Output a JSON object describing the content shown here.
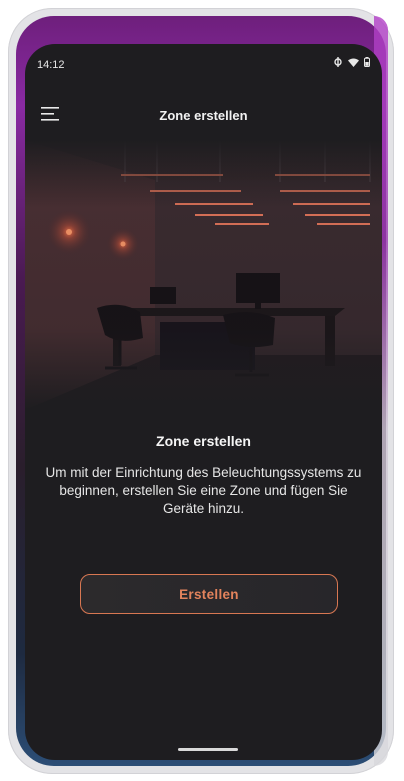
{
  "status_bar": {
    "time": "14:12",
    "icons": [
      "sync-icon",
      "wifi-icon",
      "battery-icon"
    ]
  },
  "app_bar": {
    "title": "Zone erstellen",
    "menu_icon": "hamburger-menu-icon"
  },
  "content": {
    "title": "Zone erstellen",
    "description": "Um mit der Einrichtung des Beleuchtungssystems zu beginnen, erstellen Sie eine Zone und fügen Sie Geräte hinzu.",
    "button_label": "Erstellen"
  },
  "colors": {
    "background": "#1e1d20",
    "accent": "#e3835c",
    "frame_gradient_top": "#8a2aa3",
    "frame_gradient_bottom": "#2c4e76"
  }
}
